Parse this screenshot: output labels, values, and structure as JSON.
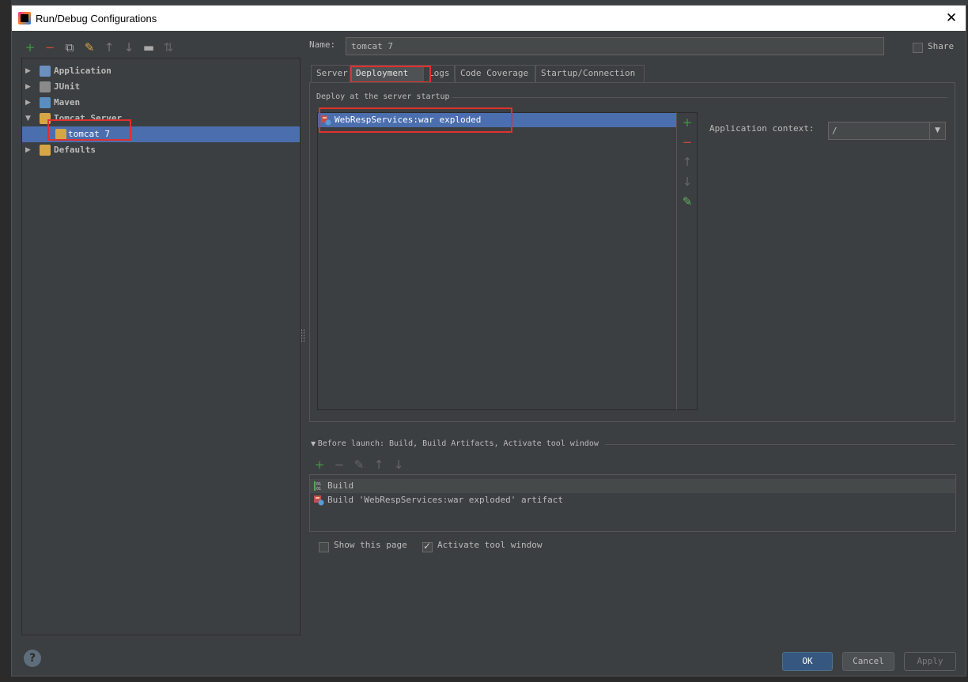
{
  "dialog": {
    "title": "Run/Debug Configurations",
    "close_label": "✕"
  },
  "left": {
    "toolbar": [
      {
        "icon": "add-icon",
        "glyph": "+",
        "color": "#3f9a3f"
      },
      {
        "icon": "remove-icon",
        "glyph": "−",
        "color": "#d04a3a"
      },
      {
        "icon": "copy-icon",
        "glyph": "⧉",
        "color": "#aaaaaa"
      },
      {
        "icon": "wrench-icon",
        "glyph": "✎",
        "color": "#d6a646"
      },
      {
        "icon": "move-up-icon",
        "glyph": "↑",
        "color": "#777777"
      },
      {
        "icon": "move-down-icon",
        "glyph": "↓",
        "color": "#777777"
      },
      {
        "icon": "folder-icon",
        "glyph": "▬",
        "color": "#aaaaaa"
      },
      {
        "icon": "sort-icon",
        "glyph": "⇅",
        "color": "#666666"
      }
    ],
    "tree": [
      {
        "label": "Application",
        "arrow": "▶",
        "icon": "application-icon",
        "color": "#6b8fbf"
      },
      {
        "label": "JUnit",
        "arrow": "▶",
        "icon": "junit-icon",
        "color": "#8a8a8a"
      },
      {
        "label": "Maven",
        "arrow": "▶",
        "icon": "maven-gear-icon",
        "color": "#5a8ec0"
      },
      {
        "label": "Tomcat Server",
        "arrow": "▼",
        "icon": "tomcat-icon",
        "color": "#d6a646"
      },
      {
        "label": "tomcat 7",
        "arrow": "",
        "icon": "tomcat-icon",
        "color": "#d6a646"
      },
      {
        "label": "Defaults",
        "arrow": "▶",
        "icon": "wrench-icon",
        "color": "#d6a646"
      }
    ],
    "help_label": "?"
  },
  "name": {
    "label": "Name:",
    "value": "tomcat 7"
  },
  "share": {
    "label": "Share"
  },
  "tabs": [
    {
      "label": "Server"
    },
    {
      "label": "Deployment"
    },
    {
      "label": "Logs"
    },
    {
      "label": "Code Coverage"
    },
    {
      "label": "Startup/Connection"
    }
  ],
  "deployment": {
    "section_title": "Deploy at the server startup",
    "artifact": "WebRespServices:war exploded",
    "side_buttons": [
      {
        "icon": "add-icon",
        "glyph": "+",
        "color": "#3f9a3f"
      },
      {
        "icon": "remove-icon",
        "glyph": "−",
        "color": "#d04a3a"
      },
      {
        "icon": "move-up-icon",
        "glyph": "↑",
        "color": "#666666"
      },
      {
        "icon": "move-down-icon",
        "glyph": "↓",
        "color": "#666666"
      },
      {
        "icon": "edit-pencil-icon",
        "glyph": "✎",
        "color": "#5fb25f"
      }
    ],
    "context_label": "Application context:",
    "context_value": "/",
    "context_arrow": "▼"
  },
  "before_launch": {
    "title": "Before launch: Build, Build Artifacts, Activate tool window",
    "toolbar": [
      {
        "icon": "add-icon",
        "glyph": "+",
        "color": "#3f9a3f"
      },
      {
        "icon": "remove-icon",
        "glyph": "−",
        "color": "#666666"
      },
      {
        "icon": "edit-pencil-icon",
        "glyph": "✎",
        "color": "#666666"
      },
      {
        "icon": "move-up-icon",
        "glyph": "↑",
        "color": "#666666"
      },
      {
        "icon": "move-down-icon",
        "glyph": "↓",
        "color": "#666666"
      }
    ],
    "items": [
      {
        "label": "Build",
        "icon": "build-icon"
      },
      {
        "label": "Build 'WebRespServices:war exploded' artifact",
        "icon": "artifact-icon"
      }
    ]
  },
  "options": {
    "show_page_label": "Show this page",
    "show_page_checked": false,
    "activate_label": "Activate tool window",
    "activate_checked": true
  },
  "buttons": {
    "ok": "OK",
    "cancel": "Cancel",
    "apply": "Apply"
  },
  "colors": {
    "selection": "#4b6eaf",
    "highlight_box": "#e0302f",
    "dialog_bg": "#3c3f41"
  }
}
